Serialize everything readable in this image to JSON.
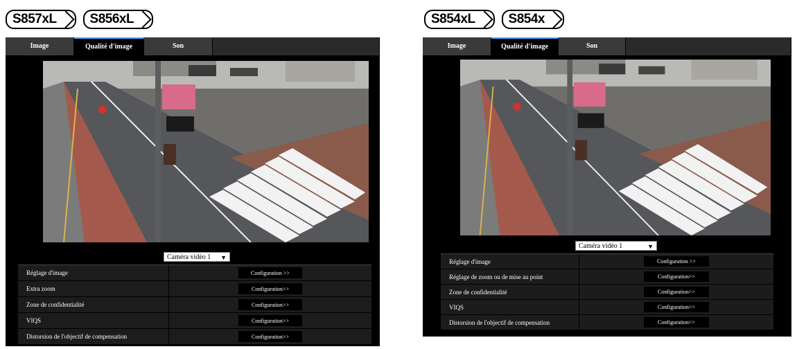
{
  "left": {
    "models": [
      "S857xL",
      "S856xL"
    ],
    "tabs": [
      "Image",
      "Qualité d'image",
      "Son"
    ],
    "active_tab": "Qualité d'image",
    "camera_select": "Caméra vidéo 1",
    "rows": [
      {
        "label": "Réglage d'image",
        "button": "Configuration >>"
      },
      {
        "label": "Extra zoom",
        "button": "Configuration>>"
      },
      {
        "label": "Zone de confidentialité",
        "button": "Configuration>>"
      },
      {
        "label": "VIQS",
        "button": "Configuration>>"
      },
      {
        "label": "Distorsion de l'objectif de compensation",
        "button": "Configuration>>"
      }
    ]
  },
  "right": {
    "models": [
      "S854xL",
      "S854x"
    ],
    "tabs": [
      "Image",
      "Qualité d'image",
      "Son"
    ],
    "active_tab": "Qualité d'image",
    "camera_select": "Caméra vidéo 1",
    "rows": [
      {
        "label": "Réglage d'image",
        "button": "Configuration >>"
      },
      {
        "label": "Réglage de zoom ou de mise au point",
        "button": "Configuration>>"
      },
      {
        "label": "Zone de confidentialité",
        "button": "Configuration>>"
      },
      {
        "label": "VIQS",
        "button": "Configuration>>"
      },
      {
        "label": "Distorsion de l'objectif de compensation",
        "button": "Configuration>>"
      }
    ]
  },
  "colors": {
    "panel_bg": "#000000",
    "tab_active_accent": "#4da3ff",
    "row_bg": "#1c1c1c"
  }
}
